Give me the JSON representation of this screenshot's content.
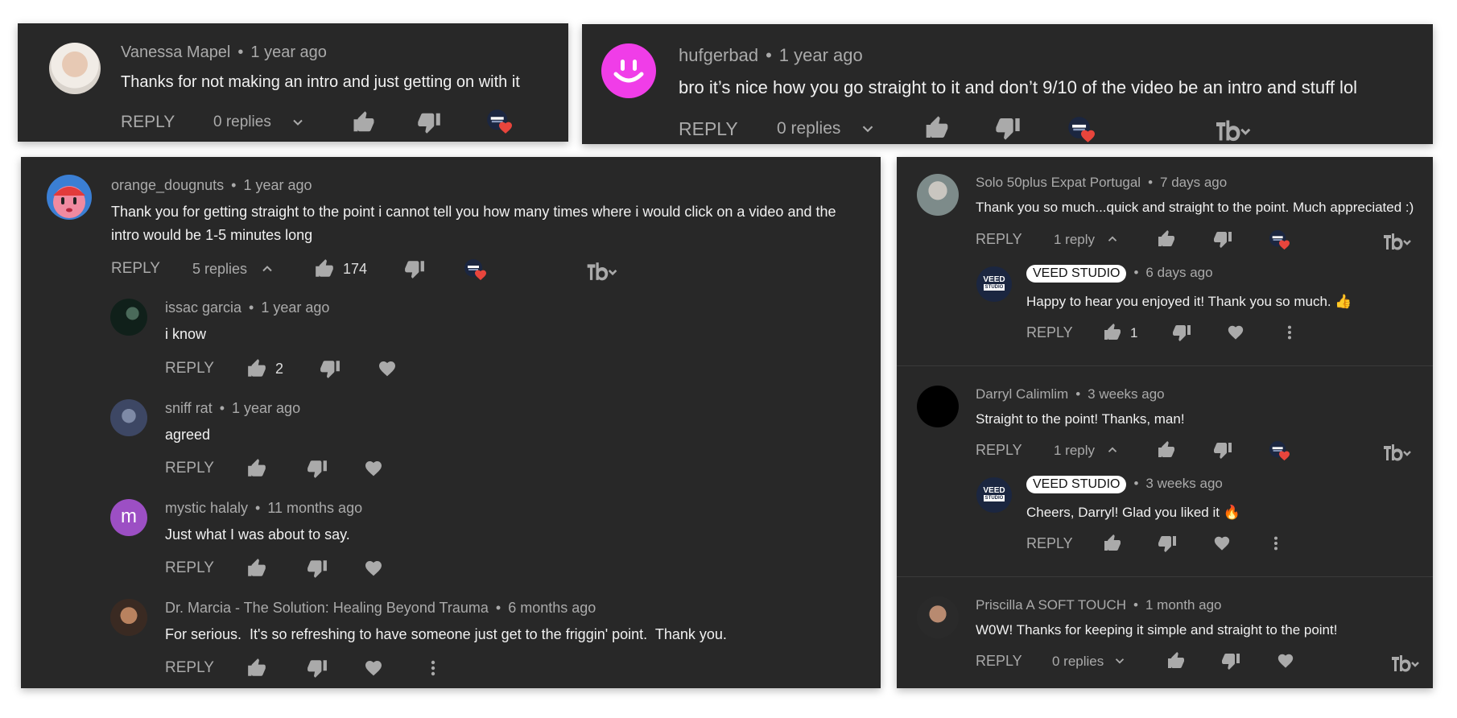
{
  "labels": {
    "reply": "REPLY",
    "sep": "•"
  },
  "colors": {
    "card_bg": "#282828",
    "muted": "#aaaaaa",
    "text": "#f1f1f1",
    "heart": "#e8453c",
    "veed_bg": "#1b2640",
    "avatar_pink": "#f03de8",
    "avatar_purple": "#9c4fc4"
  },
  "card1": {
    "author": "Vanessa Mapel",
    "time": "1 year ago",
    "text": "Thanks for not making an intro and just getting on with it",
    "replies": "0 replies"
  },
  "card2": {
    "author": "hufgerbad",
    "time": "1 year ago",
    "text": "bro it’s nice how you go straight to it and don’t 9/10 of the video be an intro and stuff lol",
    "replies": "0 replies"
  },
  "card3": {
    "author": "orange_dougnuts",
    "time": "1 year ago",
    "text1": "Thank you for getting straight to the point i cannot tell you how many times where i would click on a video and the",
    "text2": "intro would be 1-5 minutes long",
    "replies": "5 replies",
    "likes": "174",
    "replies_list": [
      {
        "author": "issac garcia",
        "time": "1 year ago",
        "text": "i know",
        "likes": "2"
      },
      {
        "author": "sniff rat",
        "time": "1 year ago",
        "text": "agreed",
        "likes": ""
      },
      {
        "author": "mystic halaly",
        "time": "11 months ago",
        "text": "Just what I was about to say.",
        "likes": "",
        "initial": "m"
      },
      {
        "author": "Dr. Marcia - The Solution: Healing Beyond Trauma",
        "time": "6 months ago",
        "text": "For serious.  It's so refreshing to have someone just get to the friggin' point.  Thank you.",
        "likes": ""
      }
    ]
  },
  "card4": {
    "threads": [
      {
        "author": "Solo 50plus Expat Portugal",
        "time": "7 days ago",
        "text": "Thank you so much...quick and straight to the point. Much appreciated :)",
        "replies": "1 reply",
        "reply": {
          "author": "VEED STUDIO",
          "time": "6 days ago",
          "text": "Happy to hear you enjoyed it! Thank you so much. 👍",
          "likes": "1"
        }
      },
      {
        "author": "Darryl Calimlim",
        "time": "3 weeks ago",
        "text": "Straight to the point! Thanks, man!",
        "replies": "1 reply",
        "reply": {
          "author": "VEED STUDIO",
          "time": "3 weeks ago",
          "text": "Cheers, Darryl! Glad you liked it 🔥",
          "likes": ""
        }
      },
      {
        "author": "Priscilla A SOFT TOUCH",
        "time": "1 month ago",
        "text": "W0W! Thanks for keeping it simple and straight to the point!",
        "replies": "0 replies"
      }
    ],
    "veed_logo_line1": "VEED",
    "veed_logo_line2": "STUDIO"
  }
}
